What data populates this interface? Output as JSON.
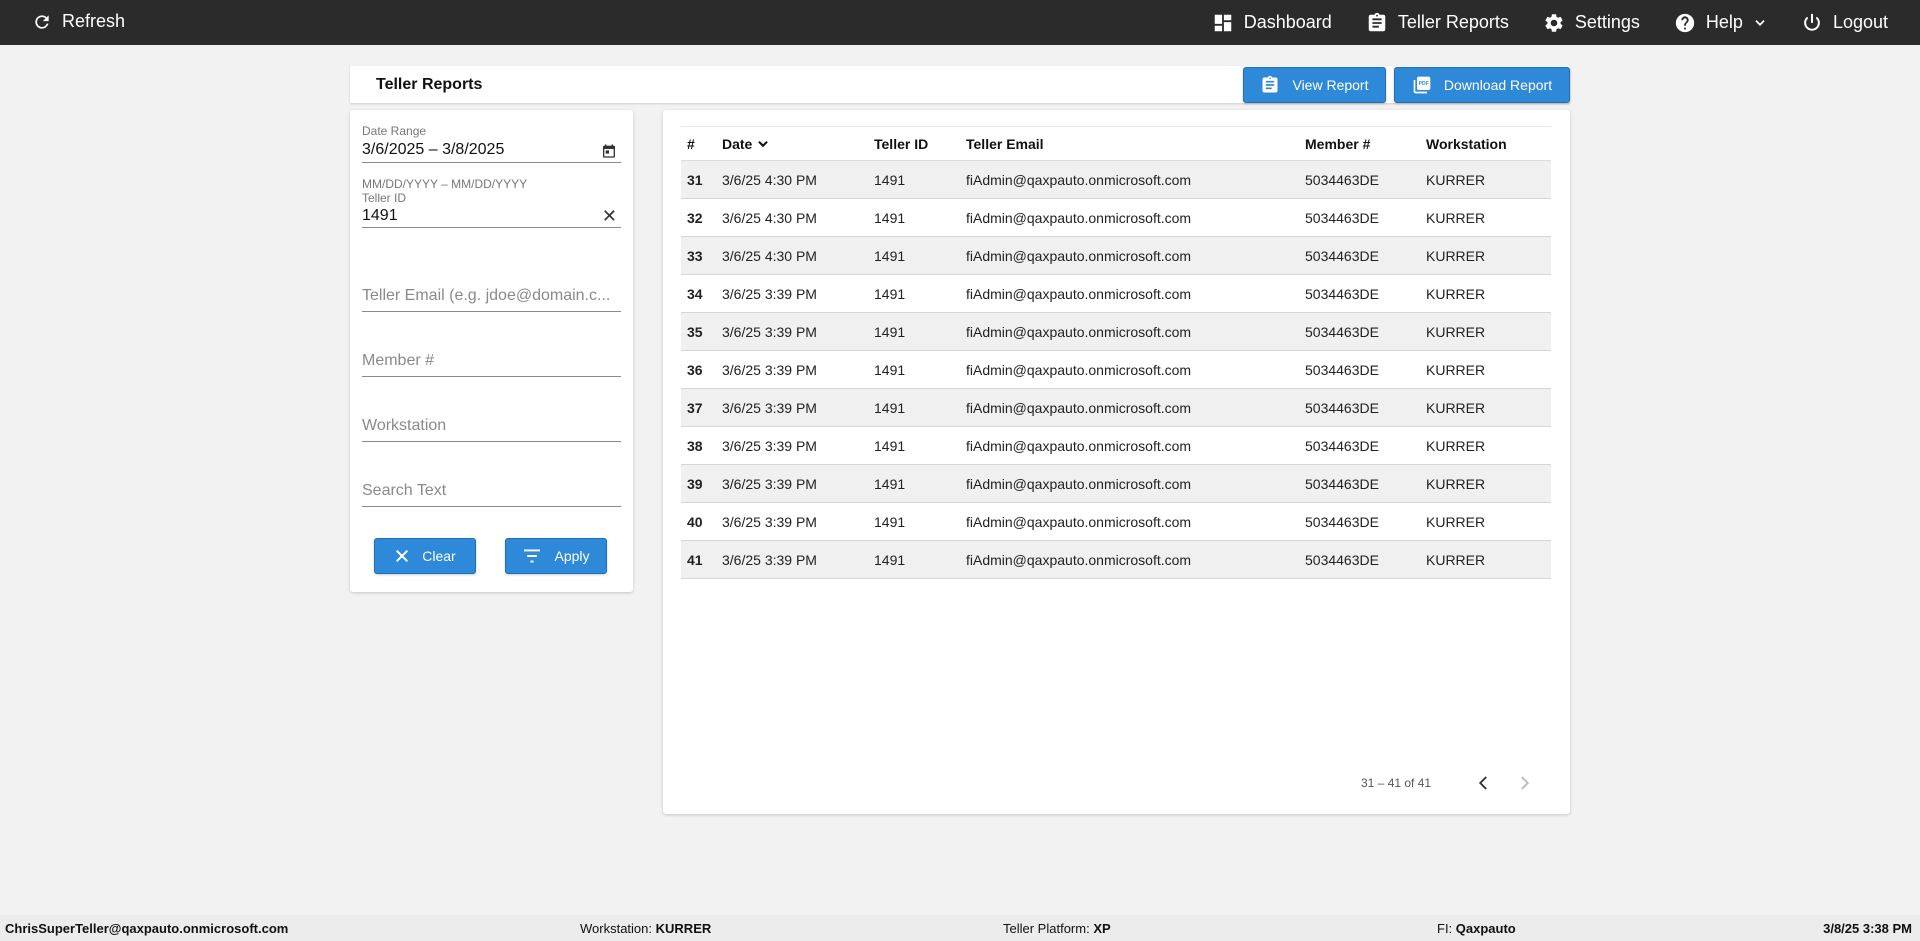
{
  "topbar": {
    "refresh_label": "Refresh",
    "nav": [
      {
        "label": "Dashboard",
        "icon": "dashboard-icon"
      },
      {
        "label": "Teller Reports",
        "icon": "clipboard-icon"
      },
      {
        "label": "Settings",
        "icon": "gear-icon"
      },
      {
        "label": "Help",
        "icon": "help-icon"
      },
      {
        "label": "Logout",
        "icon": "power-icon"
      }
    ]
  },
  "header": {
    "title": "Teller Reports",
    "view_report_label": "View Report",
    "download_report_label": "Download Report"
  },
  "filters": {
    "date_range": {
      "label": "Date Range",
      "value": "3/6/2025 – 3/8/2025",
      "hint": "MM/DD/YYYY – MM/DD/YYYY"
    },
    "teller_id": {
      "label": "Teller ID",
      "value": "1491"
    },
    "teller_email": {
      "placeholder": "Teller Email (e.g. jdoe@domain.c..."
    },
    "member": {
      "placeholder": "Member #"
    },
    "workstation": {
      "placeholder": "Workstation"
    },
    "search_text": {
      "placeholder": "Search Text"
    },
    "clear_label": "Clear",
    "apply_label": "Apply"
  },
  "table": {
    "columns": [
      "#",
      "Date",
      "Teller ID",
      "Teller Email",
      "Member #",
      "Workstation"
    ],
    "rows": [
      [
        "31",
        "3/6/25 4:30 PM",
        "1491",
        "fiAdmin@qaxpauto.onmicrosoft.com",
        "5034463DE",
        "KURRER"
      ],
      [
        "32",
        "3/6/25 4:30 PM",
        "1491",
        "fiAdmin@qaxpauto.onmicrosoft.com",
        "5034463DE",
        "KURRER"
      ],
      [
        "33",
        "3/6/25 4:30 PM",
        "1491",
        "fiAdmin@qaxpauto.onmicrosoft.com",
        "5034463DE",
        "KURRER"
      ],
      [
        "34",
        "3/6/25 3:39 PM",
        "1491",
        "fiAdmin@qaxpauto.onmicrosoft.com",
        "5034463DE",
        "KURRER"
      ],
      [
        "35",
        "3/6/25 3:39 PM",
        "1491",
        "fiAdmin@qaxpauto.onmicrosoft.com",
        "5034463DE",
        "KURRER"
      ],
      [
        "36",
        "3/6/25 3:39 PM",
        "1491",
        "fiAdmin@qaxpauto.onmicrosoft.com",
        "5034463DE",
        "KURRER"
      ],
      [
        "37",
        "3/6/25 3:39 PM",
        "1491",
        "fiAdmin@qaxpauto.onmicrosoft.com",
        "5034463DE",
        "KURRER"
      ],
      [
        "38",
        "3/6/25 3:39 PM",
        "1491",
        "fiAdmin@qaxpauto.onmicrosoft.com",
        "5034463DE",
        "KURRER"
      ],
      [
        "39",
        "3/6/25 3:39 PM",
        "1491",
        "fiAdmin@qaxpauto.onmicrosoft.com",
        "5034463DE",
        "KURRER"
      ],
      [
        "40",
        "3/6/25 3:39 PM",
        "1491",
        "fiAdmin@qaxpauto.onmicrosoft.com",
        "5034463DE",
        "KURRER"
      ],
      [
        "41",
        "3/6/25 3:39 PM",
        "1491",
        "fiAdmin@qaxpauto.onmicrosoft.com",
        "5034463DE",
        "KURRER"
      ]
    ],
    "pagination": "31 – 41 of 41"
  },
  "footer": {
    "user": "ChrisSuperTeller@qaxpauto.onmicrosoft.com",
    "workstation_label": "Workstation:",
    "workstation_value": "KURRER",
    "platform_label": "Teller Platform:",
    "platform_value": "XP",
    "fi_label": "FI:",
    "fi_value": "Qaxpauto",
    "datetime": "3/8/25 3:38 PM"
  },
  "colors": {
    "topbar": "#2b2b2b",
    "accent": "#2e89d8",
    "background": "#f2f2f2"
  }
}
